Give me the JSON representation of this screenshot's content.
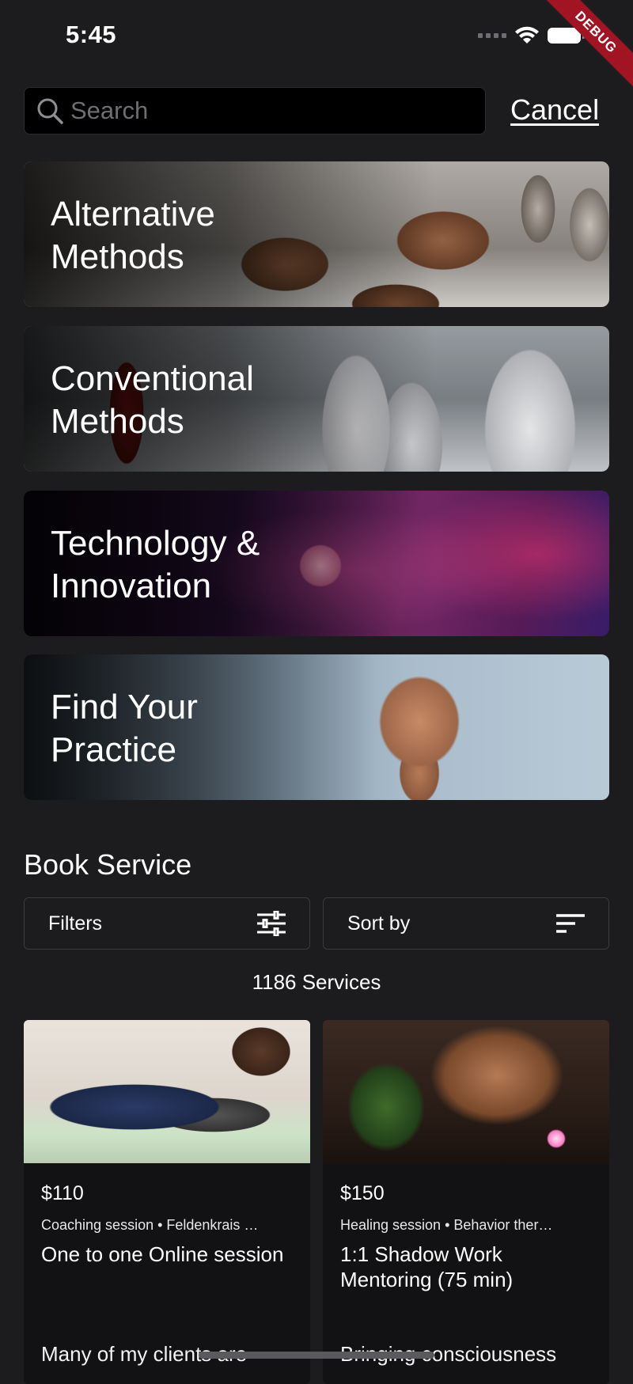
{
  "status_bar": {
    "time": "5:45",
    "debug_label": "DEBUG"
  },
  "search": {
    "placeholder": "Search",
    "value": "",
    "cancel_label": "Cancel"
  },
  "categories": [
    {
      "title": "Alternative\nMethods"
    },
    {
      "title": "Conventional\nMethods"
    },
    {
      "title": "Technology &\nInnovation"
    },
    {
      "title": "Find Your\nPractice"
    }
  ],
  "book_service": {
    "title": "Book Service",
    "filters_label": "Filters",
    "sort_label": "Sort by",
    "count_text": "1186 Services"
  },
  "services": [
    {
      "price": "$110",
      "tags": "Coaching session • Feldenkrais …",
      "title": "One to one Online session",
      "description": "Many of my clients are"
    },
    {
      "price": "$150",
      "tags": "Healing session • Behavior ther…",
      "title": "1:1 Shadow Work Mentoring (75 min)",
      "description": "Bringing consciousness"
    }
  ],
  "colors": {
    "background": "#1c1c1e",
    "search_background": "#000000",
    "card_background": "#121214",
    "debug_banner": "#a01423"
  },
  "icons": {
    "search": "search-icon",
    "filters": "sliders-icon",
    "sort": "sort-icon",
    "wifi": "wifi-icon",
    "battery": "battery-icon",
    "signal": "cellular-signal-icon"
  }
}
